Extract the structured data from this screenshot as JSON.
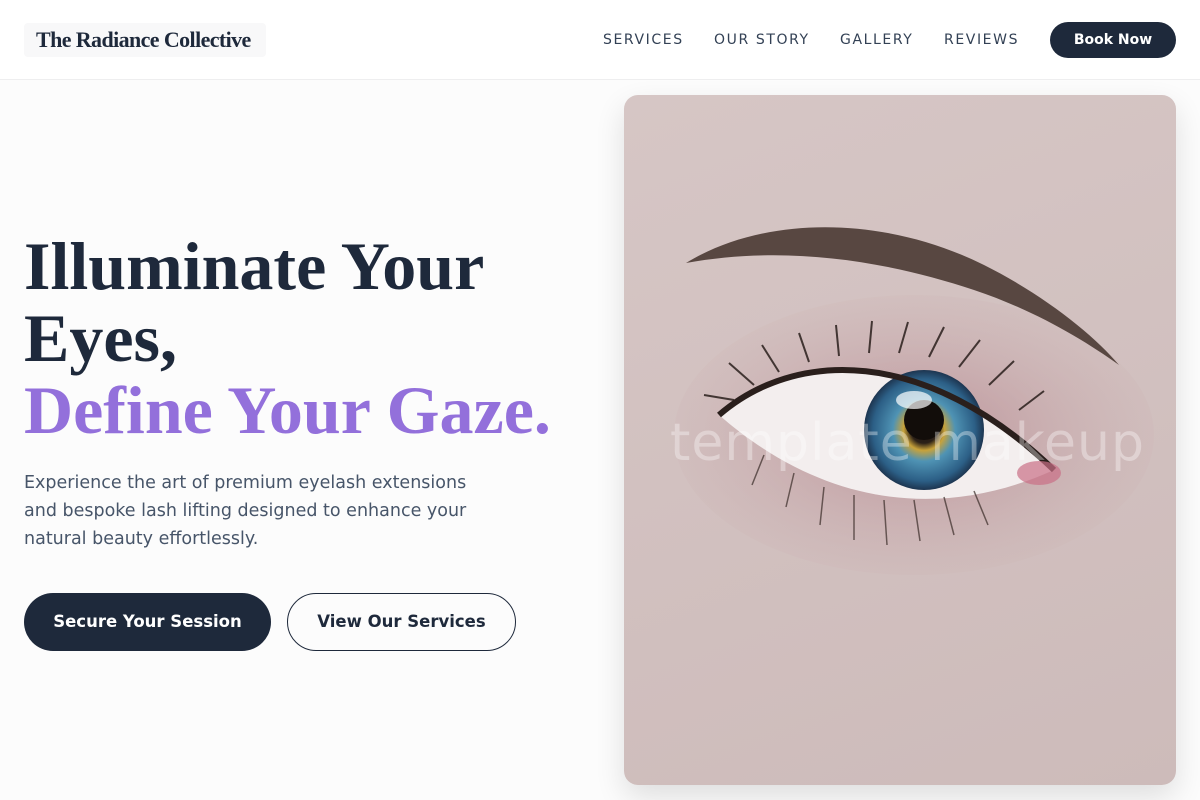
{
  "header": {
    "logo": "The Radiance Collective",
    "nav": [
      "SERVICES",
      "OUR STORY",
      "GALLERY",
      "REVIEWS"
    ],
    "cta": "Book Now"
  },
  "hero": {
    "title_line1": "Illuminate Your",
    "title_line2": "Eyes,",
    "title_line3": "Define Your Gaze.",
    "subtitle": "Experience the art of premium eyelash extensions and bespoke lash lifting designed to enhance your natural beauty effortlessly.",
    "primary_button": "Secure Your Session",
    "secondary_button": "View Our Services"
  },
  "image": {
    "watermark": "template makeup"
  },
  "colors": {
    "navy": "#1e293b",
    "accent_purple": "#9370db",
    "body_text": "#475569"
  }
}
